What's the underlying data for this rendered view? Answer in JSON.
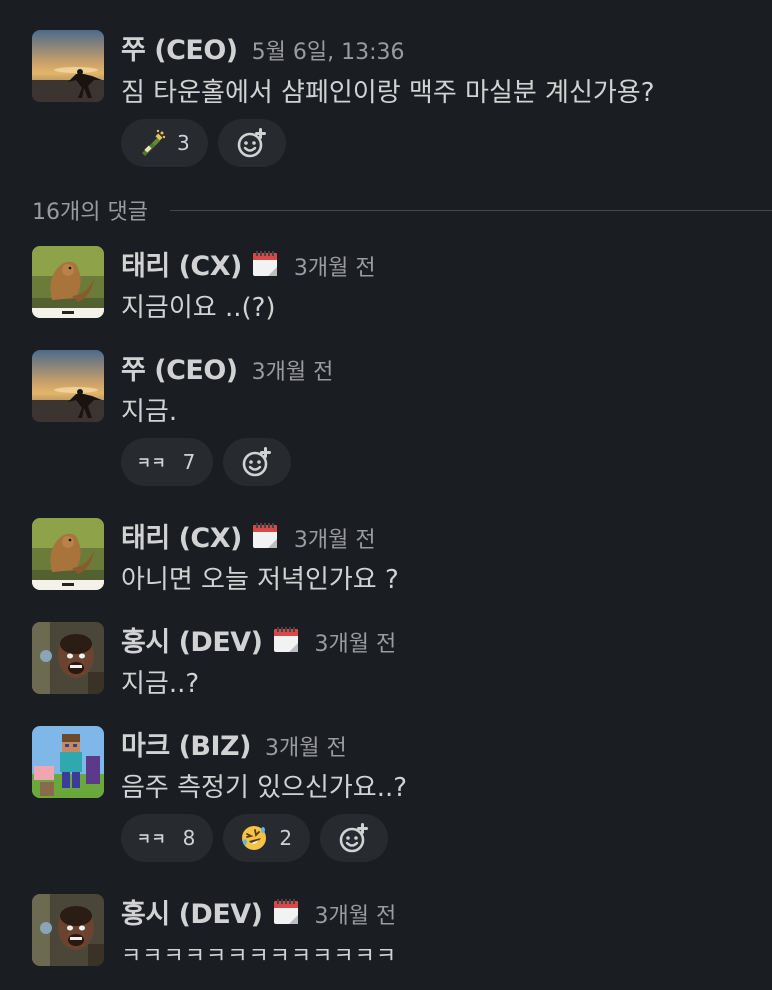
{
  "parent": {
    "name": "쭈 (CEO)",
    "time": "5월 6일, 13:36",
    "text": "짐 타운홀에서 샴페인이랑 맥주 마실분 계신가용?",
    "reactions": [
      {
        "emoji": "champagne-bottle",
        "count": "3"
      }
    ]
  },
  "replies_label": "16개의 댓글",
  "messages": [
    {
      "name": "태리 (CX)",
      "time": "3개월 전",
      "status_icon": "calendar",
      "avatar": "squirrel",
      "text": "지금이요 ..(?)"
    },
    {
      "name": "쭈 (CEO)",
      "time": "3개월 전",
      "avatar": "sunset",
      "text": "지금.",
      "reactions": [
        {
          "emoji": "ㅋㅋ",
          "count": "7"
        }
      ]
    },
    {
      "name": "태리 (CX)",
      "time": "3개월 전",
      "status_icon": "calendar",
      "avatar": "squirrel",
      "text": "아니면 오늘 저녁인가요 ?"
    },
    {
      "name": "홍시 (DEV)",
      "time": "3개월 전",
      "status_icon": "calendar",
      "avatar": "excited-man",
      "text": "지금..?"
    },
    {
      "name": "마크 (BIZ)",
      "time": "3개월 전",
      "avatar": "minecraft",
      "text": "음주 측정기 있으신가요..?",
      "reactions": [
        {
          "emoji": "ㅋㅋ",
          "count": "8"
        },
        {
          "emoji": "rolling-on-floor-laughing",
          "count": "2"
        }
      ]
    },
    {
      "name": "홍시 (DEV)",
      "time": "3개월 전",
      "status_icon": "calendar",
      "avatar": "excited-man",
      "text": "ㅋㅋㅋㅋㅋㅋㅋㅋㅋㅋㅋㅋㅋ"
    }
  ],
  "colors": {
    "background": "#1a1d21",
    "text": "#d1d2d3",
    "muted": "#9a9b9e",
    "pill": "#272a2e"
  }
}
